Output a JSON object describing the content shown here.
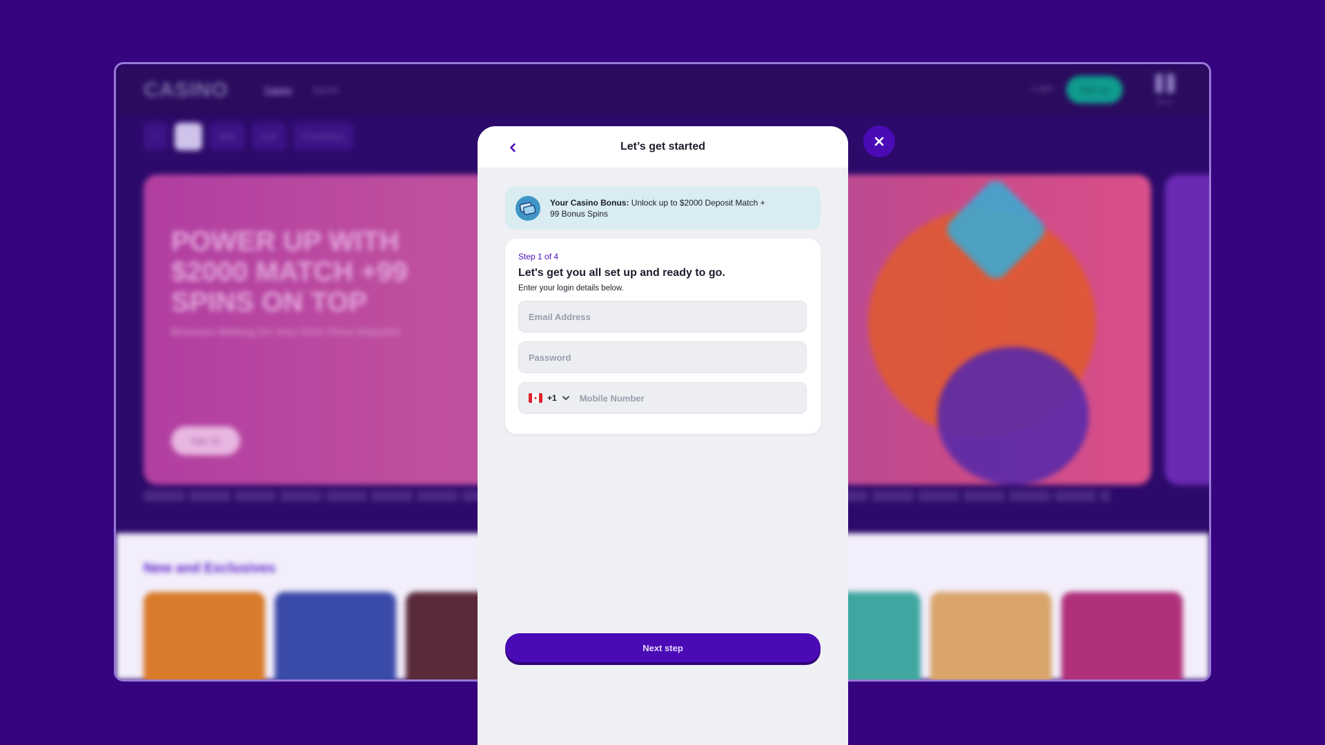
{
  "background": {
    "logo": "CASINO",
    "nav": [
      "Casino",
      "Sports"
    ],
    "login_label": "Login",
    "signup_label": "Sign up",
    "menu_label": "Menu",
    "subnav": [
      "New",
      "Live",
      "Promotions"
    ],
    "hero": {
      "title": "POWER UP WITH $2000 MATCH +99 SPINS ON TOP",
      "subtitle": "Bonuses Waiting On Your First Three Deposits",
      "button": "Sign Up"
    },
    "section_title": "New and Exclusives"
  },
  "modal": {
    "title": "Let’s get started",
    "bonus": {
      "label": "Your Casino Bonus:",
      "text": "Unlock up to $2000 Deposit Match + 99 Bonus Spins"
    },
    "step": "Step 1 of 4",
    "heading": "Let's get you all set up and ready to go.",
    "subheading": "Enter your login details below.",
    "fields": {
      "email_placeholder": "Email Address",
      "password_placeholder": "Password",
      "dial_code": "+1",
      "mobile_placeholder": "Mobile Number"
    },
    "next_label": "Next step"
  },
  "colors": {
    "page_bg": "#36047f",
    "accent": "#4a0ab6",
    "banner_bg": "#d9ecf2",
    "modal_bg": "#eff0f3"
  },
  "icons": [
    "back-chevron-icon",
    "close-icon",
    "bonus-tickets-icon",
    "canada-flag-icon",
    "chevron-down-icon"
  ]
}
